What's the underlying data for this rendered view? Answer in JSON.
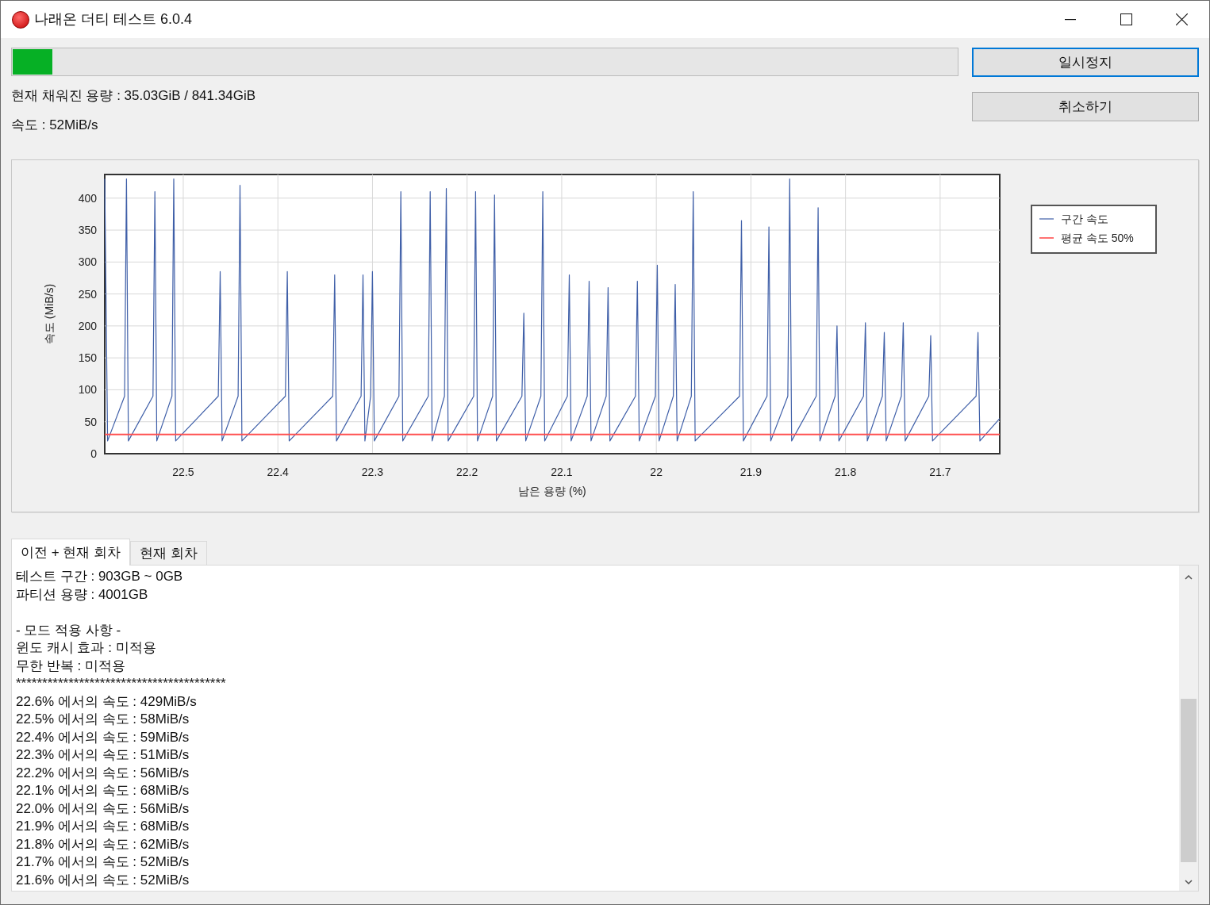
{
  "window": {
    "title": "나래온 더티 테스트 6.0.4"
  },
  "progress": {
    "level": 0.0416
  },
  "info": [
    "현재 채워진 용량 : 35.03GiB / 841.34GiB",
    "속도 : 52MiB/s"
  ],
  "buttons": [
    {
      "label": "일시정지",
      "focused": true
    },
    {
      "label": "취소하기",
      "focused": false
    }
  ],
  "chart_data": {
    "type": "line",
    "grid": true,
    "legend": true,
    "xlabel": "남은 용량 (%)",
    "ylabel": "속도 (MiB/s)",
    "xlim": [
      22.583,
      21.637
    ],
    "ylim": [
      0,
      437
    ],
    "xticks": [
      22.5,
      22.4,
      22.3,
      22.2,
      22.1,
      {
        "value": 22,
        "label": "22"
      },
      21.9,
      21.8,
      21.7
    ],
    "yticks": [
      0,
      50,
      100,
      150,
      200,
      250,
      300,
      350,
      400
    ],
    "x": [
      22.583,
      22.58,
      22.562,
      22.56,
      22.558,
      22.532,
      22.53,
      22.528,
      22.512,
      22.51,
      22.508,
      22.463,
      22.461,
      22.459,
      22.442,
      22.44,
      22.438,
      22.392,
      22.39,
      22.388,
      22.342,
      22.34,
      22.338,
      22.312,
      22.31,
      22.308,
      22.302,
      22.3,
      22.298,
      22.272,
      22.27,
      22.268,
      22.241,
      22.239,
      22.237,
      22.224,
      22.222,
      22.22,
      22.193,
      22.191,
      22.189,
      22.173,
      22.171,
      22.169,
      22.142,
      22.14,
      22.138,
      22.122,
      22.12,
      22.118,
      22.094,
      22.092,
      22.09,
      22.073,
      22.071,
      22.069,
      22.053,
      22.051,
      22.049,
      22.022,
      22.02,
      22.018,
      22.001,
      21.999,
      21.997,
      21.982,
      21.98,
      21.978,
      21.963,
      21.961,
      21.959,
      21.912,
      21.91,
      21.908,
      21.883,
      21.881,
      21.879,
      21.861,
      21.859,
      21.857,
      21.831,
      21.829,
      21.827,
      21.811,
      21.809,
      21.807,
      21.781,
      21.779,
      21.777,
      21.761,
      21.759,
      21.757,
      21.741,
      21.739,
      21.737,
      21.712,
      21.71,
      21.708,
      21.662,
      21.66,
      21.658,
      21.637
    ],
    "series": [
      {
        "name": "구간 속도",
        "color": "#3f5fa8",
        "values": [
          430,
          20,
          90,
          430,
          20,
          90,
          410,
          20,
          90,
          430,
          20,
          90,
          285,
          20,
          90,
          420,
          20,
          90,
          285,
          20,
          90,
          280,
          20,
          90,
          280,
          20,
          90,
          285,
          20,
          90,
          410,
          20,
          90,
          410,
          20,
          90,
          415,
          20,
          90,
          410,
          20,
          90,
          405,
          20,
          90,
          220,
          20,
          90,
          410,
          20,
          90,
          280,
          20,
          90,
          270,
          20,
          90,
          260,
          20,
          90,
          270,
          20,
          90,
          295,
          20,
          90,
          265,
          20,
          90,
          410,
          20,
          90,
          365,
          20,
          90,
          355,
          20,
          90,
          430,
          20,
          90,
          385,
          20,
          90,
          200,
          20,
          90,
          205,
          20,
          90,
          190,
          20,
          90,
          205,
          20,
          90,
          185,
          20,
          90,
          190,
          20,
          55
        ]
      },
      {
        "name": "평균 속도 50%",
        "color": "#ff5050",
        "values": [
          30,
          30,
          30,
          30,
          30,
          30,
          30,
          30,
          30,
          30,
          30,
          30,
          30,
          30,
          30,
          30,
          30,
          30,
          30,
          30,
          30,
          30,
          30,
          30,
          30,
          30,
          30,
          30,
          30,
          30,
          30,
          30,
          30,
          30,
          30,
          30,
          30,
          30,
          30,
          30,
          30,
          30,
          30,
          30,
          30,
          30,
          30,
          30,
          30,
          30,
          30,
          30,
          30,
          30,
          30,
          30,
          30,
          30,
          30,
          30,
          30,
          30,
          30,
          30,
          30,
          30,
          30,
          30,
          30,
          30,
          30,
          30,
          30,
          30,
          30,
          30,
          30,
          30,
          30,
          30,
          30,
          30,
          30,
          30,
          30,
          30,
          30,
          30,
          30,
          30,
          30,
          30,
          30,
          30,
          30,
          30,
          30,
          30,
          30,
          30,
          30,
          30
        ]
      }
    ]
  },
  "tabs": [
    {
      "label": "이전 + 현재 회차",
      "selected": true
    },
    {
      "label": "현재 회차",
      "selected": false
    }
  ],
  "log": [
    [
      "테스트 구간 : 903GB ~ 0GB",
      "파티션 용량 : 4001GB"
    ],
    [
      "- 모드 적용 사항 -",
      "윈도 캐시 효과 : 미적용",
      "무한 반복 : 미적용",
      "****************************************",
      "22.6% 에서의 속도 : 429MiB/s",
      "22.5% 에서의 속도 : 58MiB/s",
      "22.4% 에서의 속도 : 59MiB/s",
      "22.3% 에서의 속도 : 51MiB/s",
      "22.2% 에서의 속도 : 56MiB/s",
      "22.1% 에서의 속도 : 68MiB/s",
      "22.0% 에서의 속도 : 56MiB/s",
      "21.9% 에서의 속도 : 68MiB/s",
      "21.8% 에서의 속도 : 62MiB/s",
      "21.7% 에서의 속도 : 52MiB/s",
      "21.6% 에서의 속도 : 52MiB/s"
    ]
  ]
}
